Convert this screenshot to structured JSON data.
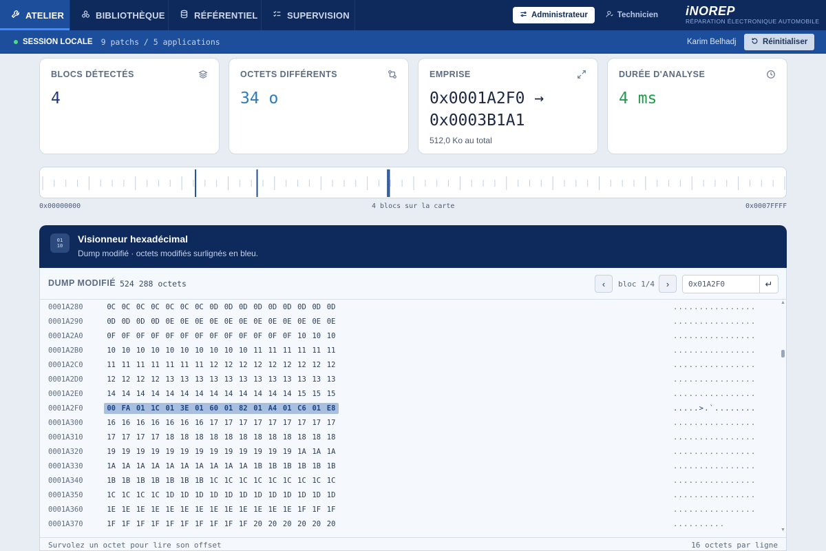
{
  "nav": {
    "tabs": [
      {
        "label": "ATELIER",
        "icon": "wrench-icon",
        "active": true
      },
      {
        "label": "BIBLIOTHÈQUE",
        "icon": "grid-icon",
        "active": false
      },
      {
        "label": "RÉFÉRENTIEL",
        "icon": "database-icon",
        "active": false
      },
      {
        "label": "SUPERVISION",
        "icon": "checklist-icon",
        "active": false
      }
    ],
    "roles": [
      {
        "label": "Administrateur",
        "icon": "sliders-icon",
        "active": true
      },
      {
        "label": "Technicien",
        "icon": "user-icon",
        "active": false
      }
    ],
    "brand": {
      "name": "iNOREP",
      "subtitle": "RÉPARATION ÉLECTRONIQUE AUTOMOBILE"
    }
  },
  "session": {
    "label": "SESSION LOCALE",
    "info": "9 patchs / 5 applications",
    "user": "Karim Belhadj",
    "reset_label": "Réinitialiser",
    "status_color": "#4ade80"
  },
  "cards": [
    {
      "title": "BLOCS DÉTECTÉS",
      "icon": "layers-icon",
      "value": "4",
      "color": "#1e3a7a"
    },
    {
      "title": "OCTETS DIFFÉRENTS",
      "icon": "diff-icon",
      "value": "34 o",
      "color": "#2b7bbf"
    },
    {
      "title": "EMPRISE",
      "icon": "expand-icon",
      "value_line1": "0x0001A2F0 →",
      "value_line2": "0x0003B1A1",
      "sub": "512,0 Ko au total",
      "color": "#1b2744"
    },
    {
      "title": "DURÉE D'ANALYSE",
      "icon": "clock-icon",
      "value": "4 ms",
      "color": "#1f9d4a"
    }
  ],
  "map": {
    "start": "0x00000000",
    "end": "0x0007FFFF",
    "center_label": "4 blocs sur la carte",
    "block_positions": [
      0.206,
      0.289,
      0.465,
      0.467
    ]
  },
  "hex_viewer": {
    "title": "Visionneur hexadécimal",
    "subtitle": "Dump modifié · octets modifiés surlignés en bleu.",
    "dump_title": "DUMP MODIFIÉ",
    "dump_size": "524 288 octets",
    "bloc_label": "bloc 1/4",
    "goto_value": "0x01A2F0",
    "footer_left": "Survolez un octet pour lire son offset",
    "footer_right": "16 octets par ligne",
    "rows": [
      {
        "offset": "0001A280",
        "bytes": [
          "0C",
          "0C",
          "0C",
          "0C",
          "0C",
          "0C",
          "0C",
          "0D",
          "0D",
          "0D",
          "0D",
          "0D",
          "0D",
          "0D",
          "0D",
          "0D"
        ],
        "ascii": "................",
        "modified": false
      },
      {
        "offset": "0001A290",
        "bytes": [
          "0D",
          "0D",
          "0D",
          "0D",
          "0E",
          "0E",
          "0E",
          "0E",
          "0E",
          "0E",
          "0E",
          "0E",
          "0E",
          "0E",
          "0E",
          "0E"
        ],
        "ascii": "................",
        "modified": false
      },
      {
        "offset": "0001A2A0",
        "bytes": [
          "0F",
          "0F",
          "0F",
          "0F",
          "0F",
          "0F",
          "0F",
          "0F",
          "0F",
          "0F",
          "0F",
          "0F",
          "0F",
          "10",
          "10",
          "10"
        ],
        "ascii": "................",
        "modified": false
      },
      {
        "offset": "0001A2B0",
        "bytes": [
          "10",
          "10",
          "10",
          "10",
          "10",
          "10",
          "10",
          "10",
          "10",
          "10",
          "11",
          "11",
          "11",
          "11",
          "11",
          "11"
        ],
        "ascii": "................",
        "modified": false
      },
      {
        "offset": "0001A2C0",
        "bytes": [
          "11",
          "11",
          "11",
          "11",
          "11",
          "11",
          "11",
          "12",
          "12",
          "12",
          "12",
          "12",
          "12",
          "12",
          "12",
          "12"
        ],
        "ascii": "................",
        "modified": false
      },
      {
        "offset": "0001A2D0",
        "bytes": [
          "12",
          "12",
          "12",
          "12",
          "13",
          "13",
          "13",
          "13",
          "13",
          "13",
          "13",
          "13",
          "13",
          "13",
          "13",
          "13"
        ],
        "ascii": "................",
        "modified": false
      },
      {
        "offset": "0001A2E0",
        "bytes": [
          "14",
          "14",
          "14",
          "14",
          "14",
          "14",
          "14",
          "14",
          "14",
          "14",
          "14",
          "14",
          "14",
          "15",
          "15",
          "15"
        ],
        "ascii": "................",
        "modified": false
      },
      {
        "offset": "0001A2F0",
        "bytes": [
          "00",
          "FA",
          "01",
          "1C",
          "01",
          "3E",
          "01",
          "60",
          "01",
          "82",
          "01",
          "A4",
          "01",
          "C6",
          "01",
          "E8"
        ],
        "ascii": ".....>.`........",
        "modified": true
      },
      {
        "offset": "0001A300",
        "bytes": [
          "16",
          "16",
          "16",
          "16",
          "16",
          "16",
          "16",
          "17",
          "17",
          "17",
          "17",
          "17",
          "17",
          "17",
          "17",
          "17"
        ],
        "ascii": "................",
        "modified": false
      },
      {
        "offset": "0001A310",
        "bytes": [
          "17",
          "17",
          "17",
          "17",
          "18",
          "18",
          "18",
          "18",
          "18",
          "18",
          "18",
          "18",
          "18",
          "18",
          "18",
          "18"
        ],
        "ascii": "................",
        "modified": false
      },
      {
        "offset": "0001A320",
        "bytes": [
          "19",
          "19",
          "19",
          "19",
          "19",
          "19",
          "19",
          "19",
          "19",
          "19",
          "19",
          "19",
          "19",
          "1A",
          "1A",
          "1A"
        ],
        "ascii": "................",
        "modified": false
      },
      {
        "offset": "0001A330",
        "bytes": [
          "1A",
          "1A",
          "1A",
          "1A",
          "1A",
          "1A",
          "1A",
          "1A",
          "1A",
          "1A",
          "1B",
          "1B",
          "1B",
          "1B",
          "1B",
          "1B"
        ],
        "ascii": "................",
        "modified": false
      },
      {
        "offset": "0001A340",
        "bytes": [
          "1B",
          "1B",
          "1B",
          "1B",
          "1B",
          "1B",
          "1B",
          "1C",
          "1C",
          "1C",
          "1C",
          "1C",
          "1C",
          "1C",
          "1C",
          "1C"
        ],
        "ascii": "................",
        "modified": false
      },
      {
        "offset": "0001A350",
        "bytes": [
          "1C",
          "1C",
          "1C",
          "1C",
          "1D",
          "1D",
          "1D",
          "1D",
          "1D",
          "1D",
          "1D",
          "1D",
          "1D",
          "1D",
          "1D",
          "1D"
        ],
        "ascii": "................",
        "modified": false
      },
      {
        "offset": "0001A360",
        "bytes": [
          "1E",
          "1E",
          "1E",
          "1E",
          "1E",
          "1E",
          "1E",
          "1E",
          "1E",
          "1E",
          "1E",
          "1E",
          "1E",
          "1F",
          "1F",
          "1F"
        ],
        "ascii": "................",
        "modified": false
      },
      {
        "offset": "0001A370",
        "bytes": [
          "1F",
          "1F",
          "1F",
          "1F",
          "1F",
          "1F",
          "1F",
          "1F",
          "1F",
          "1F",
          "20",
          "20",
          "20",
          "20",
          "20",
          "20"
        ],
        "ascii": "..........      ",
        "modified": false
      }
    ]
  },
  "colors": {
    "nav_bg": "#0e2a5c",
    "session_bg": "#1d4e9b",
    "highlight": "#a8bfe0",
    "page_bg": "#e8edf3"
  }
}
